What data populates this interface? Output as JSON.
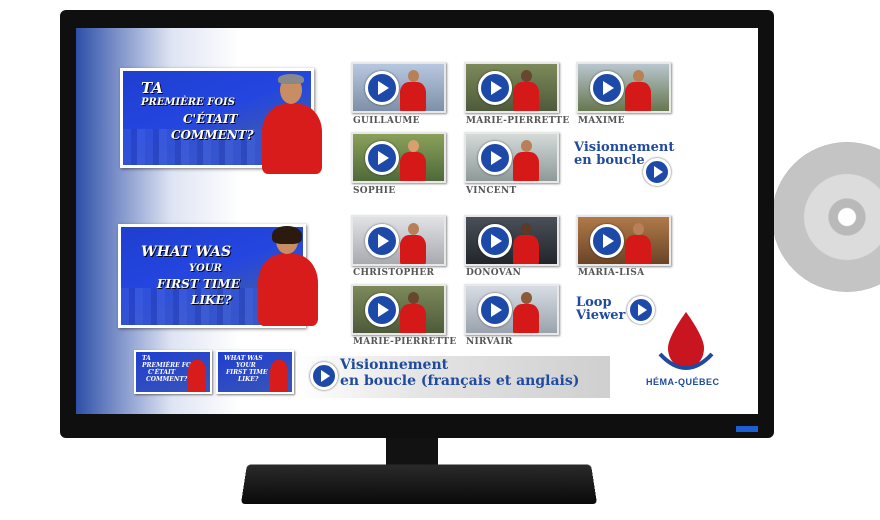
{
  "banners": {
    "fr_line1": "TA",
    "fr_line2": "PREMIÈRE FOIS",
    "fr_line3": "C'ÉTAIT",
    "fr_line4": "COMMENT?",
    "en_line1": "WHAT WAS",
    "en_line2": "YOUR",
    "en_line3": "FIRST TIME",
    "en_line4": "LIKE?"
  },
  "videos_fr": [
    {
      "name": "GUILLAUME",
      "bg": "#8fa6c8"
    },
    {
      "name": "MARIE-PIERRETTE",
      "bg": "#5f6a48"
    },
    {
      "name": "MAXIME",
      "bg": "#7c8a6a"
    },
    {
      "name": "SOPHIE",
      "bg": "#6a8450"
    },
    {
      "name": "VINCENT",
      "bg": "#a9b3b0"
    }
  ],
  "videos_en": [
    {
      "name": "CHRISTOPHER",
      "bg": "#c7c9cc"
    },
    {
      "name": "DONOVAN",
      "bg": "#3a4048"
    },
    {
      "name": "MARIA-LISA",
      "bg": "#8a5a3a"
    },
    {
      "name": "MARIE-PIERRETTE",
      "bg": "#5f6a48"
    },
    {
      "name": "NIRVAIR",
      "bg": "#b8c0cc"
    }
  ],
  "loop_fr": {
    "line1": "Visionnement",
    "line2": "en boucle"
  },
  "loop_en": {
    "line1": "Loop",
    "line2": "Viewer"
  },
  "bottom": {
    "line1": "Visionnement",
    "line2": "en boucle (français et anglais)"
  },
  "logo": {
    "label": "HÉMA-QUÉBEC"
  },
  "colors": {
    "accent": "#1f4a9e",
    "shirt": "#d81c1c",
    "logo_red": "#c8151f"
  }
}
